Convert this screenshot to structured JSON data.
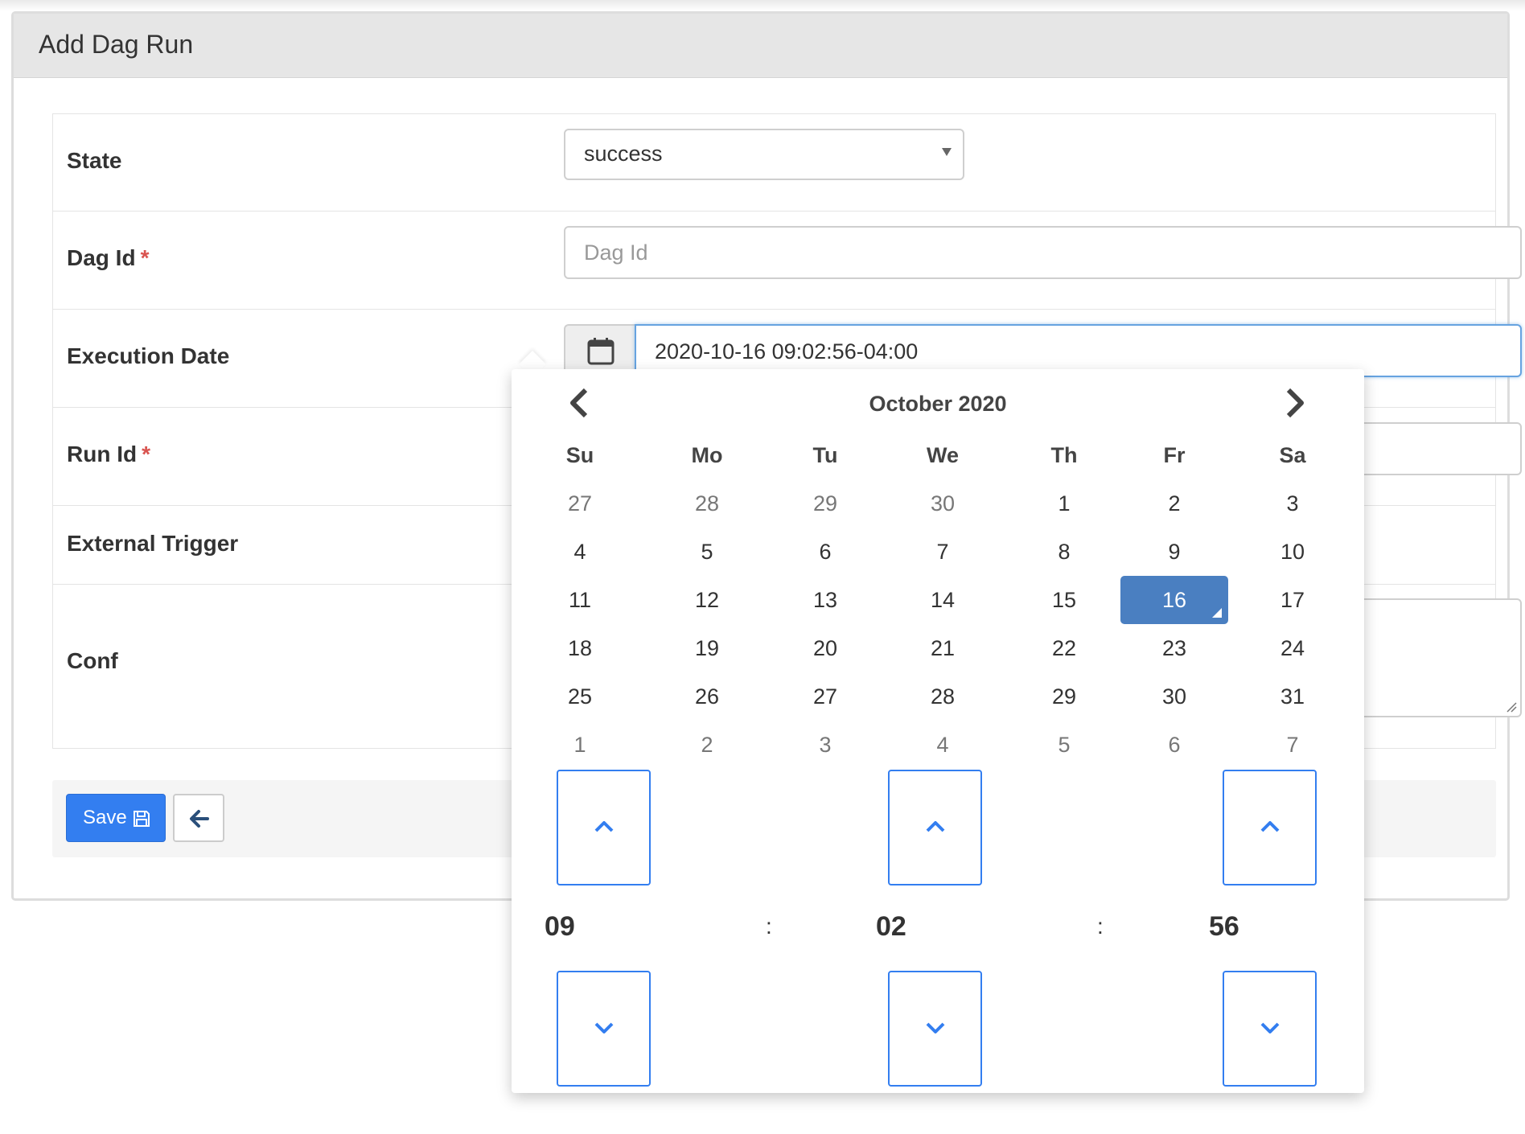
{
  "panel": {
    "title": "Add Dag Run"
  },
  "form": {
    "state": {
      "label": "State",
      "value": "success"
    },
    "dag_id": {
      "label": "Dag Id",
      "required_mark": "*",
      "placeholder": "Dag Id",
      "value": ""
    },
    "execution_date": {
      "label": "Execution Date",
      "value": "2020-10-16 09:02:56-04:00"
    },
    "run_id": {
      "label": "Run Id",
      "required_mark": "*"
    },
    "external_trigger": {
      "label": "External Trigger"
    },
    "conf": {
      "label": "Conf"
    }
  },
  "buttons": {
    "save_label": "Save",
    "back_icon": "arrow-left-icon",
    "save_icon": "floppy-disk-icon"
  },
  "datepicker": {
    "month_title": "October 2020",
    "prev_icon": "chevron-left-icon",
    "next_icon": "chevron-right-icon",
    "weekdays": [
      "Su",
      "Mo",
      "Tu",
      "We",
      "Th",
      "Fr",
      "Sa"
    ],
    "weeks": [
      [
        "27",
        "28",
        "29",
        "30",
        "1",
        "2",
        "3"
      ],
      [
        "4",
        "5",
        "6",
        "7",
        "8",
        "9",
        "10"
      ],
      [
        "11",
        "12",
        "13",
        "14",
        "15",
        "16",
        "17"
      ],
      [
        "18",
        "19",
        "20",
        "21",
        "22",
        "23",
        "24"
      ],
      [
        "25",
        "26",
        "27",
        "28",
        "29",
        "30",
        "31"
      ],
      [
        "1",
        "2",
        "3",
        "4",
        "5",
        "6",
        "7"
      ]
    ],
    "selected_day": "16",
    "time": {
      "hours": "09",
      "minutes": "02",
      "seconds": "56",
      "separator": ":"
    }
  },
  "colors": {
    "accent": "#337ef0",
    "selected_day": "#4a7fc1",
    "required": "#d9534f",
    "heading_bg": "#e6e6e6"
  }
}
